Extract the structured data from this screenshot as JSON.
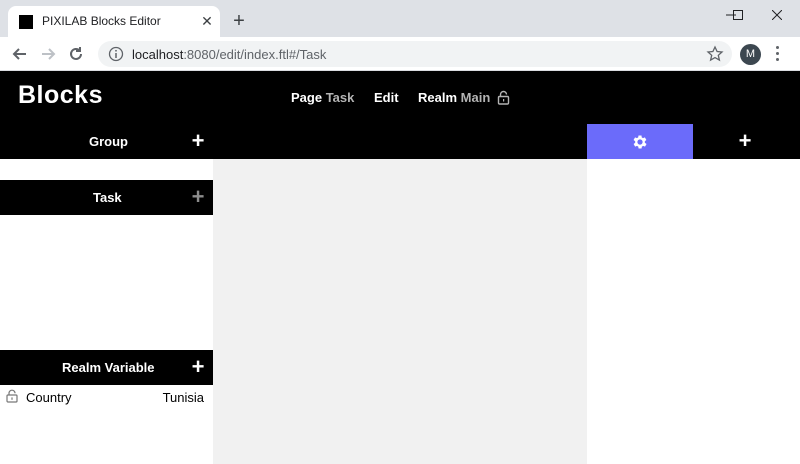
{
  "browser": {
    "tab_title": "PIXILAB Blocks Editor",
    "tab_close": "✕",
    "new_tab": "+",
    "url_host": "localhost",
    "url_rest": ":8080/edit/index.ftl#/Task",
    "profile_initial": "M"
  },
  "header": {
    "logo": "Blocks",
    "page_label": "Page",
    "page_value": "Task",
    "edit_label": "Edit",
    "realm_label": "Realm",
    "realm_value": "Main"
  },
  "sections": {
    "group": {
      "title": "Group",
      "add": "+"
    },
    "task": {
      "title": "Task",
      "add": "+"
    },
    "realm_variable": {
      "title": "Realm Variable",
      "add": "+"
    }
  },
  "realm_variables": [
    {
      "name": "Country",
      "value": "Tunisia",
      "locked": true
    }
  ],
  "right_panel": {
    "add": "+"
  },
  "colors": {
    "accent": "#6b6bfa",
    "header_bg": "#000000",
    "canvas_bg": "#f1f1f1"
  },
  "icons": {
    "settings": "gear-icon",
    "lock": "lock-icon"
  }
}
